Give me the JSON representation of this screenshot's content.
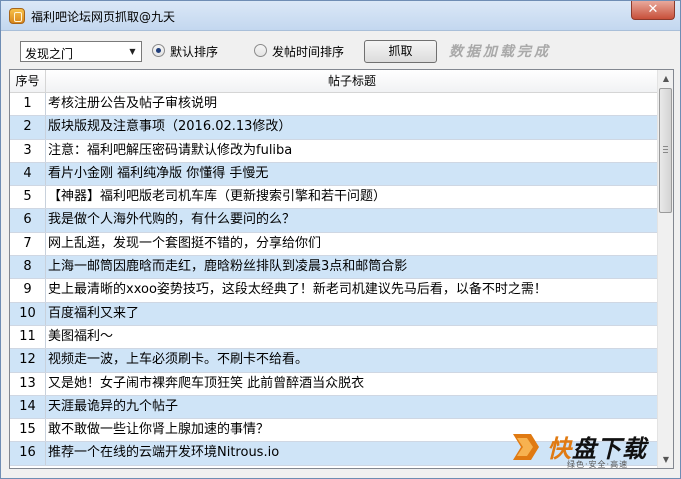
{
  "window": {
    "title": "福利吧论坛网页抓取@九天",
    "close_label": "✕"
  },
  "toolbar": {
    "forum_select": {
      "selected": "发现之门"
    },
    "sort_options": [
      {
        "label": "默认排序",
        "checked": true
      },
      {
        "label": "发帖时间排序",
        "checked": false
      }
    ],
    "grab_button": "抓取",
    "status_text": "数据加载完成"
  },
  "table": {
    "columns": [
      "序号",
      "帖子标题"
    ],
    "rows": [
      {
        "num": "1",
        "title": "考核注册公告及帖子审核说明"
      },
      {
        "num": "2",
        "title": "版块版规及注意事项（2016.02.13修改）"
      },
      {
        "num": "3",
        "title": "注意：福利吧解压密码请默认修改为fuliba"
      },
      {
        "num": "4",
        "title": "看片小金刚 福利纯净版 你懂得 手慢无"
      },
      {
        "num": "5",
        "title": "【神器】福利吧版老司机车库（更新搜索引擎和若干问题）"
      },
      {
        "num": "6",
        "title": "我是做个人海外代购的，有什么要问的么？"
      },
      {
        "num": "7",
        "title": "网上乱逛，发现一个套图挺不错的，分享给你们"
      },
      {
        "num": "8",
        "title": "上海一邮筒因鹿晗而走红，鹿晗粉丝排队到凌晨3点和邮筒合影"
      },
      {
        "num": "9",
        "title": "史上最清晰的xxoo姿势技巧，这段太经典了！新老司机建议先马后看，以备不时之需！"
      },
      {
        "num": "10",
        "title": "百度福利又来了"
      },
      {
        "num": "11",
        "title": "美图福利～"
      },
      {
        "num": "12",
        "title": "视频走一波，上车必须刷卡。不刷卡不给看。"
      },
      {
        "num": "13",
        "title": "又是她！女子闹市裸奔爬车顶狂笑 此前曾醉酒当众脱衣"
      },
      {
        "num": "14",
        "title": "天涯最诡异的九个帖子"
      },
      {
        "num": "15",
        "title": "敢不敢做一些让你肾上腺加速的事情？"
      },
      {
        "num": "16",
        "title": "推荐一个在线的云端开发环境Nitrous.io"
      }
    ]
  },
  "watermark": {
    "name_accent": "快",
    "name_rest": "盘下载",
    "slogan": "绿色·安全·高速"
  },
  "colors": {
    "row_stripe": "#cfe4f7",
    "status_text": "#a9a9a9",
    "watermark_accent": "#e07a12"
  }
}
